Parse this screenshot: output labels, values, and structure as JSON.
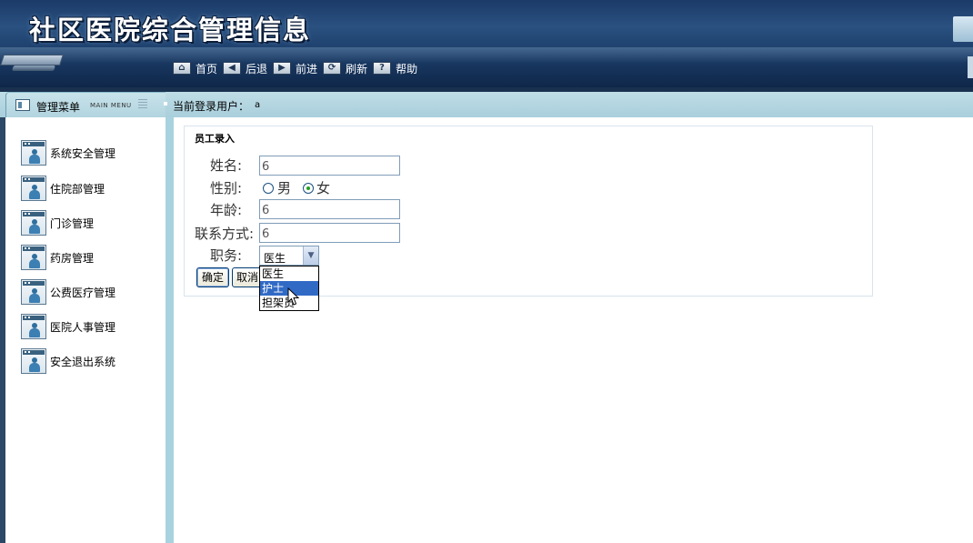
{
  "header": {
    "title": "社区医院综合管理信息",
    "toolbar": [
      {
        "icon": "home-icon",
        "glyph": "⌂",
        "label": "首页"
      },
      {
        "icon": "back-icon",
        "glyph": "◀",
        "label": "后退"
      },
      {
        "icon": "forward-icon",
        "glyph": "▶",
        "label": "前进"
      },
      {
        "icon": "refresh-icon",
        "glyph": "⟳",
        "label": "刷新"
      },
      {
        "icon": "help-icon",
        "glyph": "?",
        "label": "帮助"
      }
    ]
  },
  "infobar": {
    "menu_title": "管理菜单",
    "menu_subtitle": "MAIN MENU",
    "user_label": "当前登录用户：",
    "user_value": "a"
  },
  "sidebar": {
    "items": [
      {
        "label": "系统安全管理"
      },
      {
        "label": "住院部管理"
      },
      {
        "label": "门诊管理"
      },
      {
        "label": "药房管理"
      },
      {
        "label": "公费医疗管理"
      },
      {
        "label": "医院人事管理"
      },
      {
        "label": "安全退出系统"
      }
    ]
  },
  "form": {
    "title": "员工录入",
    "name_label": "姓名:",
    "name_value": "6",
    "gender_label": "性别:",
    "gender_male": "男",
    "gender_female": "女",
    "gender_selected": "女",
    "age_label": "年龄:",
    "age_value": "6",
    "contact_label": "联系方式:",
    "contact_value": "6",
    "position_label": "职务:",
    "position_selected": "医生",
    "position_options": [
      "医生",
      "护士",
      "担架员"
    ],
    "position_highlighted": "护士",
    "confirm_label": "确定",
    "cancel_label": "取消"
  },
  "colors": {
    "header_bg": "#1d3f6c",
    "infobar_bg": "#b1d4df",
    "dropdown_highlight": "#316ac5"
  }
}
